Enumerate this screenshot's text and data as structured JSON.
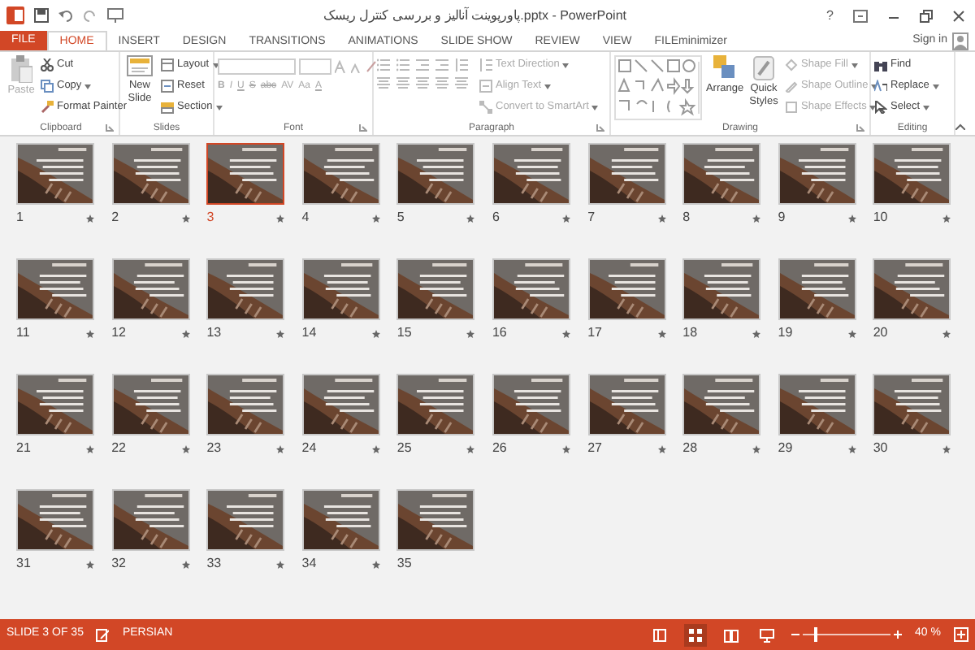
{
  "window": {
    "title": "پاورپوینت آنالیز و بررسی کنترل ریسک.pptx - PowerPoint",
    "help": "?",
    "sign_in": "Sign in"
  },
  "tabs": [
    {
      "label": "FILE",
      "kind": "file",
      "selected": false
    },
    {
      "label": "HOME",
      "kind": "tab",
      "selected": true
    },
    {
      "label": "INSERT",
      "kind": "tab",
      "selected": false
    },
    {
      "label": "DESIGN",
      "kind": "tab",
      "selected": false
    },
    {
      "label": "TRANSITIONS",
      "kind": "tab",
      "selected": false
    },
    {
      "label": "ANIMATIONS",
      "kind": "tab",
      "selected": false
    },
    {
      "label": "SLIDE SHOW",
      "kind": "tab",
      "selected": false
    },
    {
      "label": "REVIEW",
      "kind": "tab",
      "selected": false
    },
    {
      "label": "VIEW",
      "kind": "tab",
      "selected": false
    },
    {
      "label": "FILEminimizer",
      "kind": "tab",
      "selected": false
    }
  ],
  "ribbon": [
    {
      "label": "Clipboard",
      "kind": "clipboard",
      "items": [
        {
          "label": "Paste",
          "disabled": true
        },
        {
          "label": "Cut",
          "disabled": false
        },
        {
          "label": "Copy",
          "disabled": false
        },
        {
          "label": "Format Painter",
          "disabled": false
        }
      ]
    },
    {
      "label": "Slides",
      "kind": "slides",
      "items": [
        {
          "label": "New Slide",
          "disabled": false
        },
        {
          "label": "Layout",
          "disabled": false
        },
        {
          "label": "Reset",
          "disabled": false
        },
        {
          "label": "Section",
          "disabled": false
        }
      ]
    },
    {
      "label": "Font",
      "kind": "font",
      "items": [
        {
          "label": "B",
          "disabled": true
        },
        {
          "label": "I",
          "disabled": true
        },
        {
          "label": "U",
          "disabled": true
        },
        {
          "label": "S",
          "disabled": true
        },
        {
          "label": "abc",
          "disabled": true
        },
        {
          "label": "AV",
          "disabled": true
        },
        {
          "label": "Aa",
          "disabled": true
        },
        {
          "label": "A",
          "disabled": true
        }
      ]
    },
    {
      "label": "Paragraph",
      "kind": "paragraph",
      "items": [
        {
          "label": "Text Direction",
          "disabled": true
        },
        {
          "label": "Align Text",
          "disabled": true
        },
        {
          "label": "Convert to SmartArt",
          "disabled": true
        }
      ]
    },
    {
      "label": "Drawing",
      "kind": "drawing",
      "items": [
        {
          "label": "Arrange",
          "disabled": false
        },
        {
          "label": "Quick Styles",
          "disabled": false
        },
        {
          "label": "Shape Fill",
          "disabled": true
        },
        {
          "label": "Shape Outline",
          "disabled": true
        },
        {
          "label": "Shape Effects",
          "disabled": true
        }
      ]
    },
    {
      "label": "Editing",
      "kind": "editing",
      "items": [
        {
          "label": "Find",
          "disabled": false
        },
        {
          "label": "Replace",
          "disabled": false
        },
        {
          "label": "Select",
          "disabled": false
        }
      ]
    }
  ],
  "slides": [
    {
      "number": "1",
      "selected": false,
      "animated": true
    },
    {
      "number": "2",
      "selected": false,
      "animated": true
    },
    {
      "number": "3",
      "selected": true,
      "animated": true
    },
    {
      "number": "4",
      "selected": false,
      "animated": true
    },
    {
      "number": "5",
      "selected": false,
      "animated": true
    },
    {
      "number": "6",
      "selected": false,
      "animated": true
    },
    {
      "number": "7",
      "selected": false,
      "animated": true
    },
    {
      "number": "8",
      "selected": false,
      "animated": true
    },
    {
      "number": "9",
      "selected": false,
      "animated": true
    },
    {
      "number": "10",
      "selected": false,
      "animated": true
    },
    {
      "number": "11",
      "selected": false,
      "animated": true
    },
    {
      "number": "12",
      "selected": false,
      "animated": true
    },
    {
      "number": "13",
      "selected": false,
      "animated": true
    },
    {
      "number": "14",
      "selected": false,
      "animated": true
    },
    {
      "number": "15",
      "selected": false,
      "animated": true
    },
    {
      "number": "16",
      "selected": false,
      "animated": true
    },
    {
      "number": "17",
      "selected": false,
      "animated": true
    },
    {
      "number": "18",
      "selected": false,
      "animated": true
    },
    {
      "number": "19",
      "selected": false,
      "animated": true
    },
    {
      "number": "20",
      "selected": false,
      "animated": true
    },
    {
      "number": "21",
      "selected": false,
      "animated": true
    },
    {
      "number": "22",
      "selected": false,
      "animated": true
    },
    {
      "number": "23",
      "selected": false,
      "animated": true
    },
    {
      "number": "24",
      "selected": false,
      "animated": true
    },
    {
      "number": "25",
      "selected": false,
      "animated": true
    },
    {
      "number": "26",
      "selected": false,
      "animated": true
    },
    {
      "number": "27",
      "selected": false,
      "animated": true
    },
    {
      "number": "28",
      "selected": false,
      "animated": true
    },
    {
      "number": "29",
      "selected": false,
      "animated": true
    },
    {
      "number": "30",
      "selected": false,
      "animated": true
    },
    {
      "number": "31",
      "selected": false,
      "animated": true
    },
    {
      "number": "32",
      "selected": false,
      "animated": true
    },
    {
      "number": "33",
      "selected": false,
      "animated": true
    },
    {
      "number": "34",
      "selected": false,
      "animated": true
    },
    {
      "number": "35",
      "selected": false,
      "animated": false
    }
  ],
  "status_bar": {
    "slide": "SLIDE 3 OF 35",
    "language": "PERSIAN",
    "views": [
      {
        "kind": "normal",
        "selected": false
      },
      {
        "kind": "sorter",
        "selected": true
      },
      {
        "kind": "reading",
        "selected": false
      },
      {
        "kind": "slideshow",
        "selected": false
      }
    ],
    "zoom": {
      "level": 0.15,
      "reading": "40 %"
    }
  }
}
